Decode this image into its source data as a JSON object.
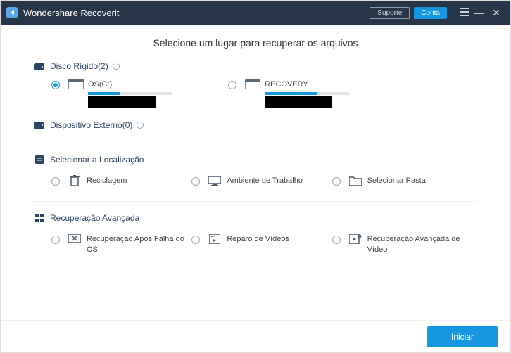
{
  "titlebar": {
    "app_name": "Wondershare Recoverit",
    "support_label": "Suporte",
    "account_label": "Conta"
  },
  "page": {
    "title": "Selecione um lugar para recuperar os arquivos"
  },
  "sections": {
    "hdd": {
      "label": "Disco Rígido(2)"
    },
    "external": {
      "label": "Dispositivo Externo(0)"
    },
    "location": {
      "label": "Selecionar a Localização"
    },
    "advanced": {
      "label": "Recuperação Avançada"
    }
  },
  "drives": [
    {
      "name": "OS(C:)",
      "used_pct": 38,
      "selected": true
    },
    {
      "name": "RECOVERY",
      "used_pct": 62,
      "selected": false
    }
  ],
  "locations": {
    "recycle": "Reciclagem",
    "desktop": "Ambiente de Trabalho",
    "folder": "Selecionar Pasta"
  },
  "advanced": {
    "crash": "Recuperação Após Falha do OS",
    "video_repair": "Reparo de Vídeos",
    "adv_video": "Recuperação Avançada de Vídeo"
  },
  "footer": {
    "start_label": "Iniciar"
  }
}
